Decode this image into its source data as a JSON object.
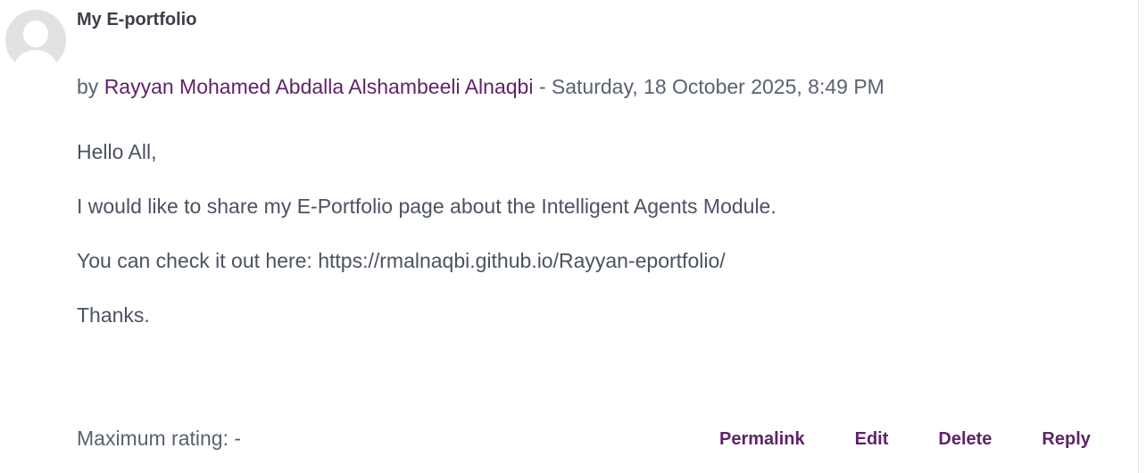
{
  "post": {
    "subject": "My E-portfolio",
    "byline": {
      "prefix": "by",
      "author": "Rayyan Mohamed Abdalla Alshambeeli Alnaqbi",
      "separator": "-",
      "date": "Saturday, 18 October 2025, 8:49 PM"
    },
    "content": [
      "Hello All,",
      "I would like to share my E-Portfolio page about the Intelligent Agents Module.",
      "You can check it out here: https://rmalnaqbi.github.io/Rayyan-eportfolio/",
      "Thanks."
    ],
    "rating": {
      "label": "Maximum rating:",
      "value": "-"
    },
    "actions": {
      "permalink": "Permalink",
      "edit": "Edit",
      "delete": "Delete",
      "reply": "Reply"
    }
  },
  "icons": {
    "avatar": "default-user-avatar-icon"
  },
  "colors": {
    "link": "#5f2368",
    "text": "#4b5261",
    "muted": "#5a6170",
    "heading": "#3a3f47"
  }
}
